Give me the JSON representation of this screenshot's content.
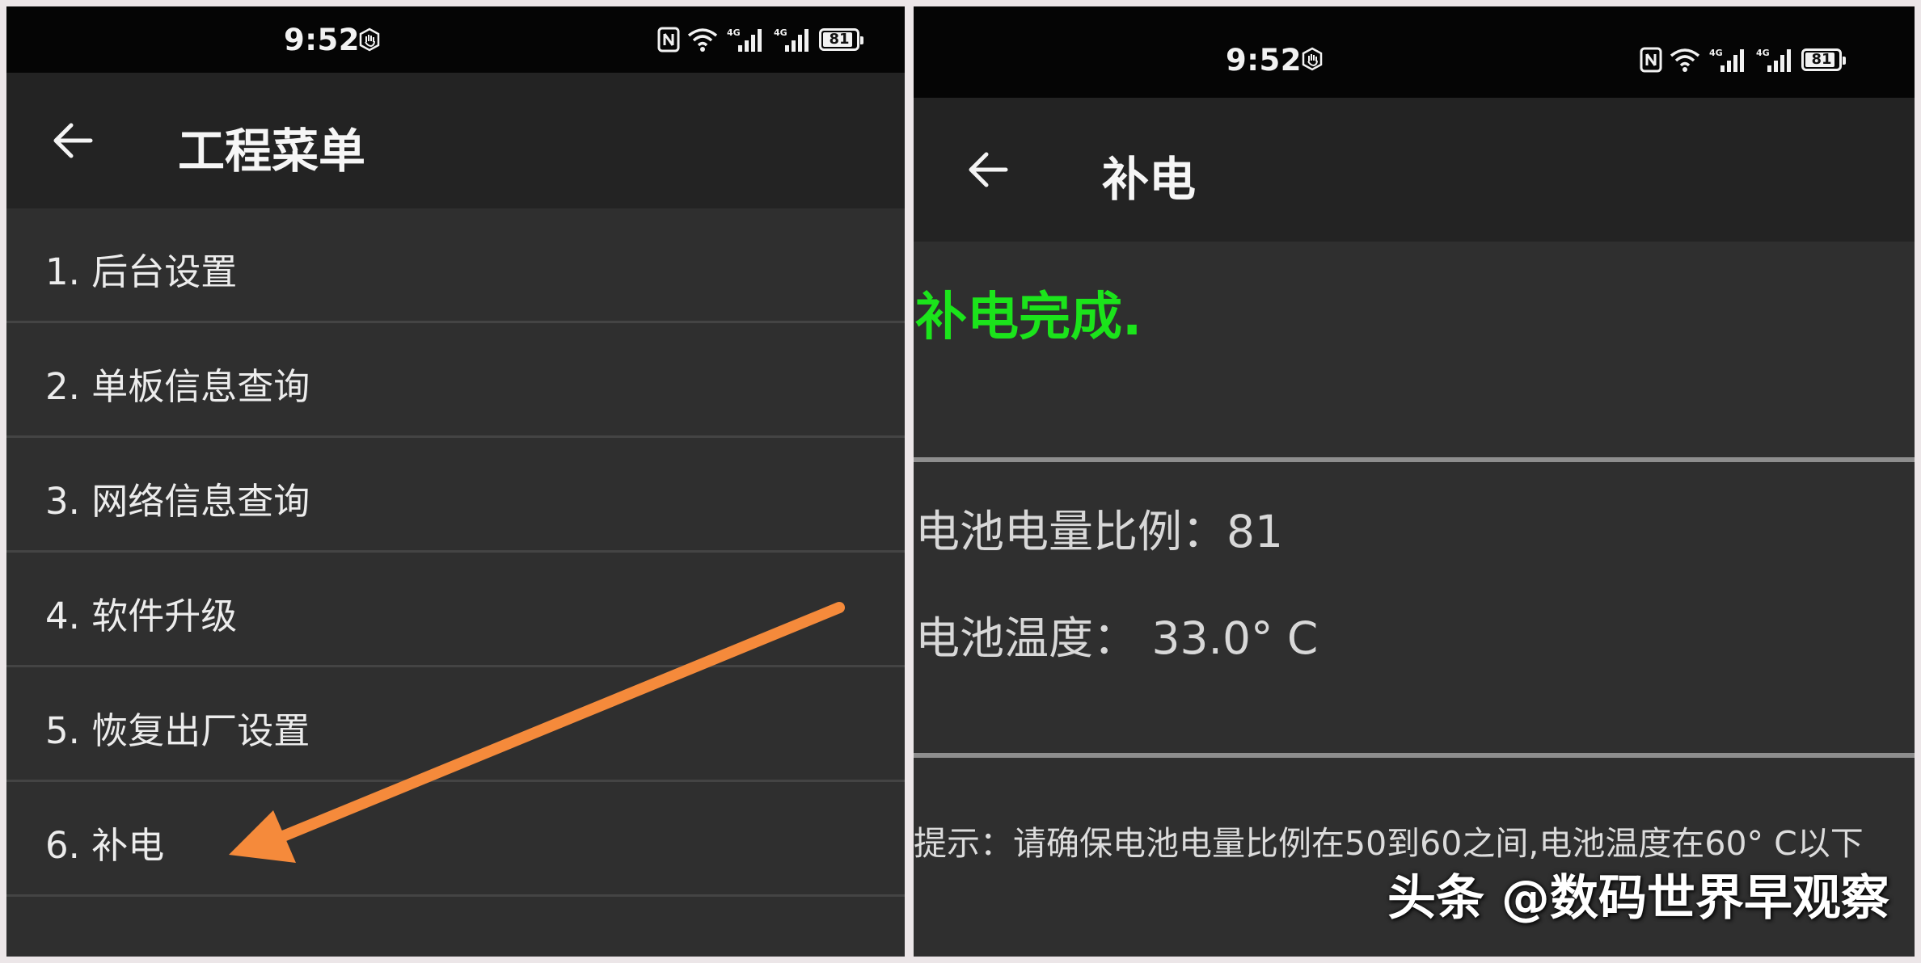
{
  "left_screen": {
    "status_bar": {
      "time": "9:52",
      "battery_level": "81",
      "network_labels": [
        "4G",
        "4G"
      ]
    },
    "app_bar": {
      "title": "工程菜单"
    },
    "menu_items": [
      {
        "label": "1. 后台设置"
      },
      {
        "label": "2. 单板信息查询"
      },
      {
        "label": "3. 网络信息查询"
      },
      {
        "label": "4. 软件升级"
      },
      {
        "label": "5. 恢复出厂设置"
      },
      {
        "label": "6. 补电"
      }
    ],
    "annotation_arrow_color": "#f58a3b"
  },
  "right_screen": {
    "status_bar": {
      "time": "9:52",
      "battery_level": "81",
      "network_labels": [
        "4G",
        "4G"
      ]
    },
    "app_bar": {
      "title": "补电"
    },
    "status_message": "补电完成.",
    "status_message_color": "#1be41b",
    "battery_percent_line": "电池电量比例：81",
    "battery_temp_line": "电池温度： 33.0° C",
    "hint": "提示：请确保电池电量比例在50到60之间,电池温度在60° C以下",
    "watermark": "头条 @数码世界早观察"
  },
  "colors": {
    "background_frame": "#ece6e8",
    "panel_bg": "#2f2f2f",
    "app_bar_bg": "#232323",
    "status_bar_bg": "#050505"
  }
}
